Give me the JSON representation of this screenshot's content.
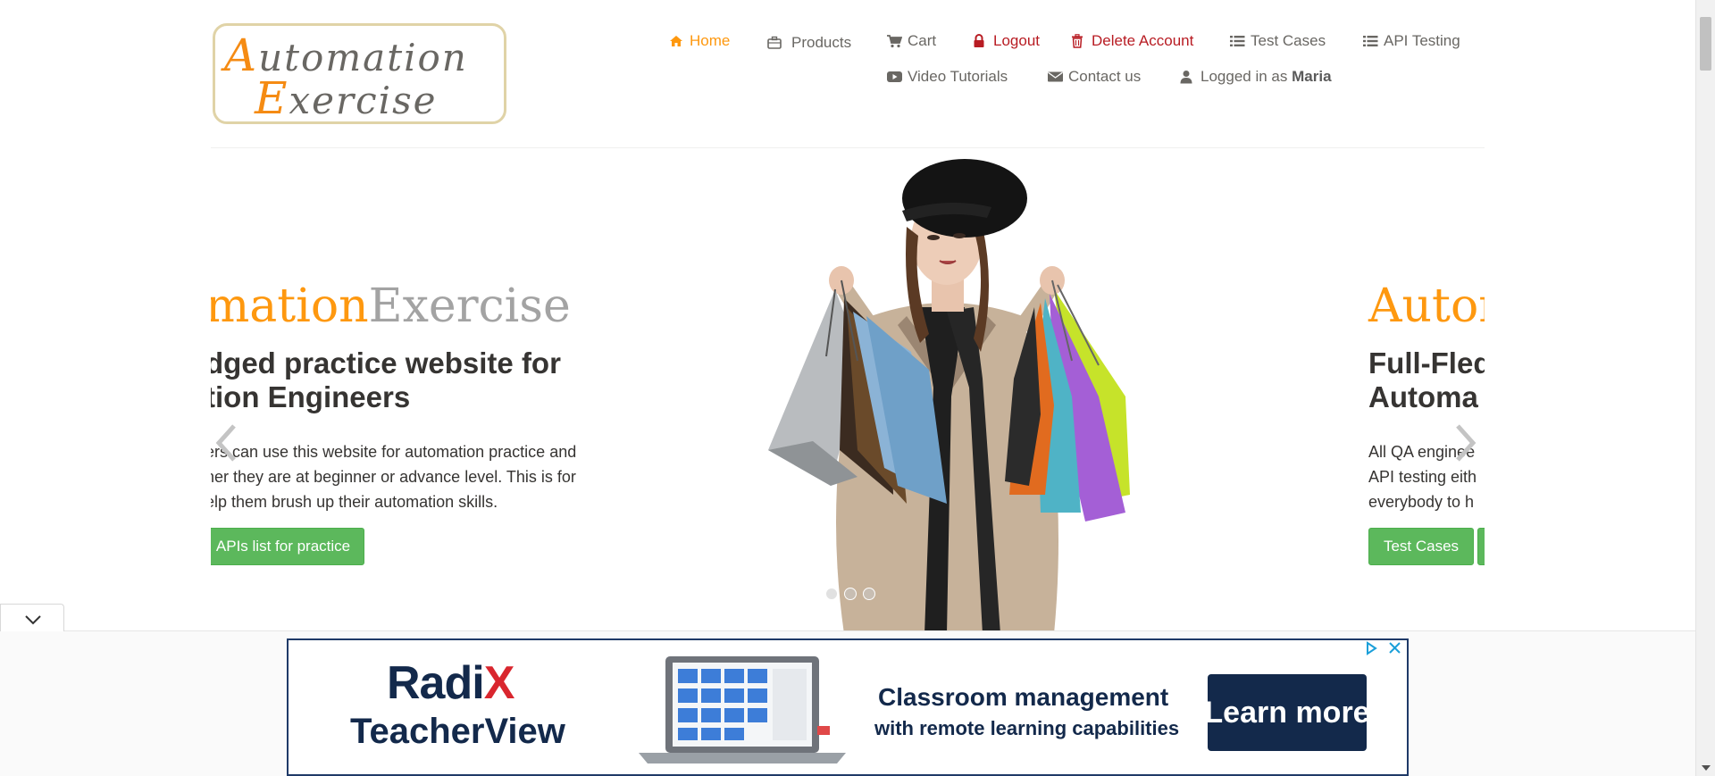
{
  "header": {
    "logo": {
      "line1_first": "A",
      "line1_rest": "utomation",
      "line2_first": "E",
      "line2_rest": "xercise"
    },
    "nav": {
      "home": "Home",
      "products": "Products",
      "cart": "Cart",
      "logout": "Logout",
      "delete_account": "Delete Account",
      "test_cases": "Test Cases",
      "api_testing": "API Testing",
      "video_tutorials": "Video Tutorials",
      "contact_us": "Contact us",
      "logged_in_prefix": "Logged in as",
      "logged_in_user": "Maria"
    }
  },
  "slider": {
    "left_slide": {
      "brand_orange": "mation",
      "brand_grey": "Exercise",
      "heading_line1": "dged practice website for",
      "heading_line2": "tion Engineers",
      "para_line1": "ers can use this website for automation practice and",
      "para_line2": "her they are at beginner or advance level. This is for",
      "para_line3": "elp them brush up their automation skills.",
      "button": "APIs list for practice"
    },
    "right_slide": {
      "brand_orange": "Autom",
      "heading_line1": "Full-Fled",
      "heading_line2": "Automa",
      "para_line1": "All QA enginee",
      "para_line2": "API testing eith",
      "para_line3": "everybody to h",
      "button": "Test Cases"
    },
    "indicators": 3
  },
  "ad": {
    "brand_main": "Radi",
    "brand_x": "X",
    "product": "TeacherView",
    "headline": "Classroom management",
    "subline": "with remote learning capabilities",
    "cta": "Learn more"
  },
  "colors": {
    "accent": "#fe980f",
    "danger": "#b81c23",
    "button_green": "#5cb85c",
    "ad_navy": "#13294b"
  },
  "icons": [
    "home-icon",
    "briefcase-icon",
    "cart-icon",
    "lock-icon",
    "trash-icon",
    "list-icon",
    "list-icon",
    "youtube-icon",
    "envelope-icon",
    "user-icon",
    "chevron-left-icon",
    "chevron-right-icon",
    "chevron-down-icon",
    "adchoices-icon",
    "close-icon"
  ]
}
